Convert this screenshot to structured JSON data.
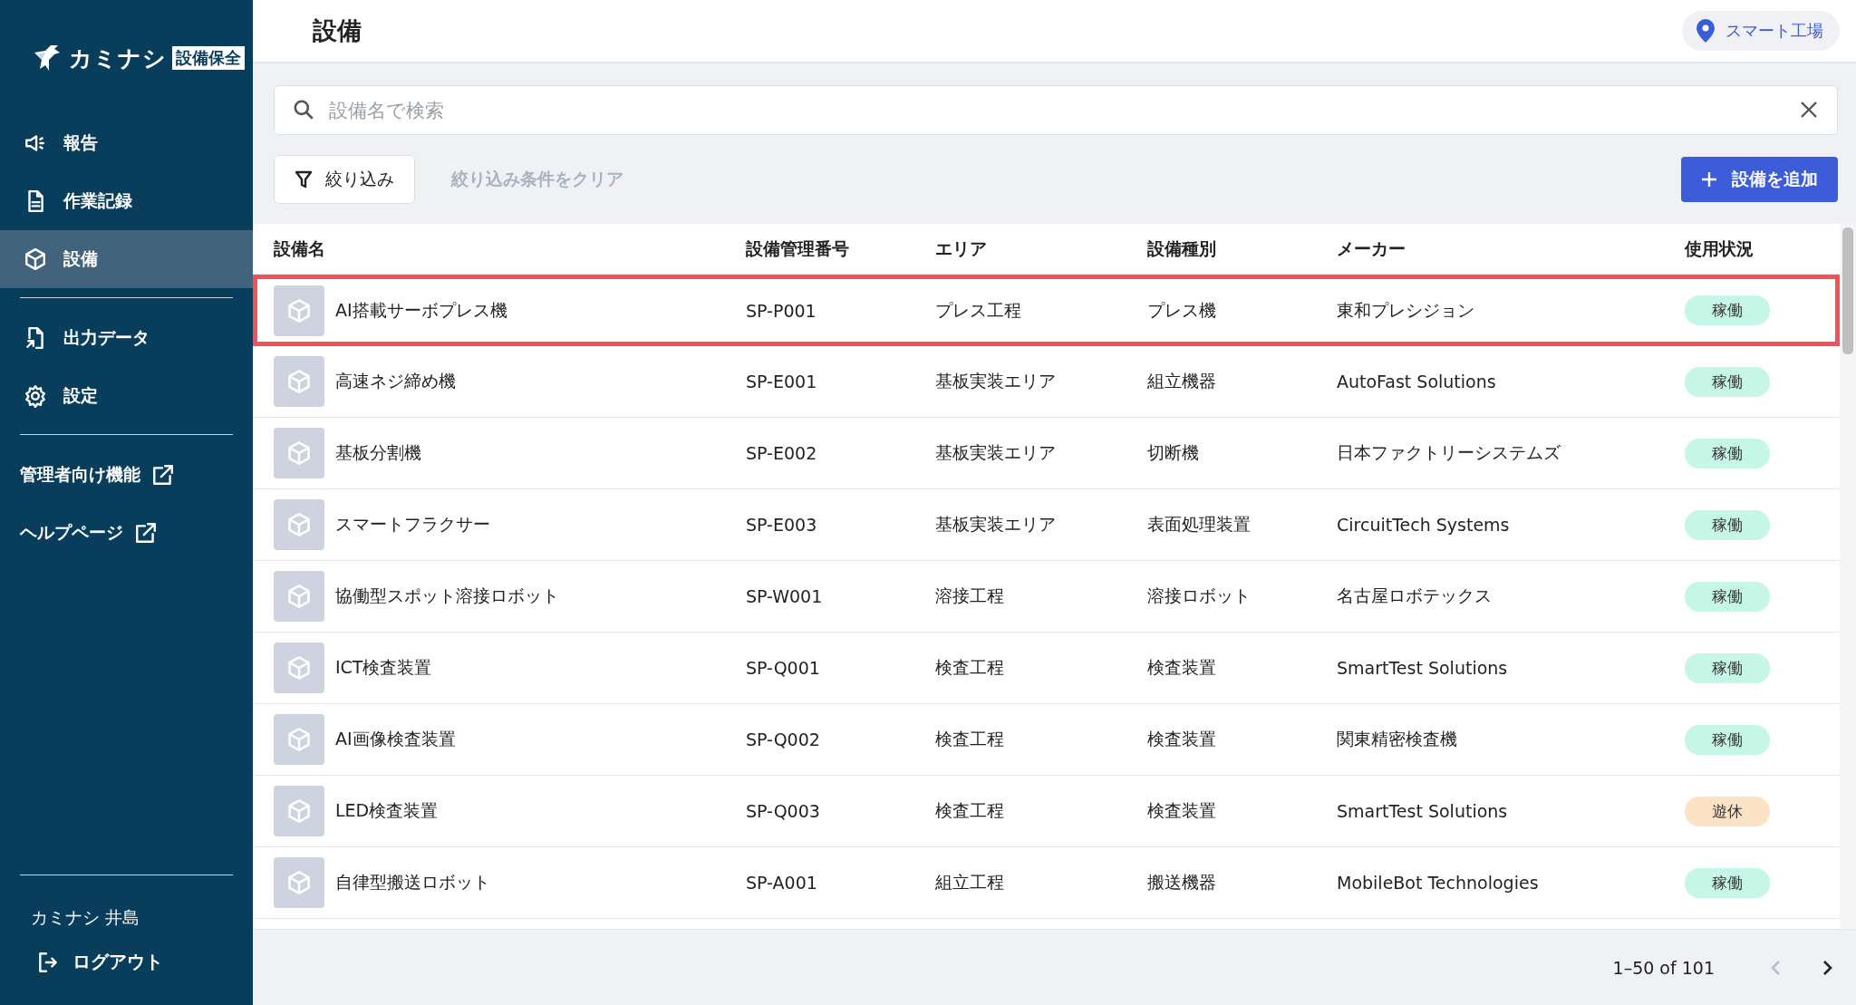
{
  "sidebar": {
    "logo": {
      "name": "カミナシ",
      "product": "設備保全"
    },
    "items": [
      {
        "label": "報告",
        "selected": false
      },
      {
        "label": "作業記録",
        "selected": false
      },
      {
        "label": "設備",
        "selected": true
      }
    ],
    "items_2": [
      {
        "label": "出力データ",
        "selected": false
      },
      {
        "label": "設定",
        "selected": false
      }
    ],
    "external_links": [
      {
        "label": "管理者向け機能"
      },
      {
        "label": "ヘルプページ"
      }
    ],
    "user": "カミナシ 井島",
    "logout": "ログアウト"
  },
  "header": {
    "title": "設備",
    "location": "スマート工場"
  },
  "search": {
    "placeholder": "設備名で検索"
  },
  "filter_button": "絞り込み",
  "clear_filter": "絞り込み条件をクリア",
  "add_button": "設備を追加",
  "table": {
    "columns": [
      "設備名",
      "設備管理番号",
      "エリア",
      "設備種別",
      "メーカー",
      "使用状況"
    ],
    "rows": [
      {
        "name": "AI搭載サーボプレス機",
        "code": "SP-P001",
        "area": "プレス工程",
        "type": "プレス機",
        "maker": "東和プレシジョン",
        "status": "稼働",
        "kind": "active",
        "selected": true
      },
      {
        "name": "高速ネジ締め機",
        "code": "SP-E001",
        "area": "基板実装エリア",
        "type": "組立機器",
        "maker": "AutoFast Solutions",
        "status": "稼働",
        "kind": "active",
        "selected": false
      },
      {
        "name": "基板分割機",
        "code": "SP-E002",
        "area": "基板実装エリア",
        "type": "切断機",
        "maker": "日本ファクトリーシステムズ",
        "status": "稼働",
        "kind": "active",
        "selected": false
      },
      {
        "name": "スマートフラクサー",
        "code": "SP-E003",
        "area": "基板実装エリア",
        "type": "表面処理装置",
        "maker": "CircuitTech Systems",
        "status": "稼働",
        "kind": "active",
        "selected": false
      },
      {
        "name": "協働型スポット溶接ロボット",
        "code": "SP-W001",
        "area": "溶接工程",
        "type": "溶接ロボット",
        "maker": "名古屋ロボテックス",
        "status": "稼働",
        "kind": "active",
        "selected": false
      },
      {
        "name": "ICT検査装置",
        "code": "SP-Q001",
        "area": "検査工程",
        "type": "検査装置",
        "maker": "SmartTest Solutions",
        "status": "稼働",
        "kind": "active",
        "selected": false
      },
      {
        "name": "AI画像検査装置",
        "code": "SP-Q002",
        "area": "検査工程",
        "type": "検査装置",
        "maker": "関東精密検査機",
        "status": "稼働",
        "kind": "active",
        "selected": false
      },
      {
        "name": "LED検査装置",
        "code": "SP-Q003",
        "area": "検査工程",
        "type": "検査装置",
        "maker": "SmartTest Solutions",
        "status": "遊休",
        "kind": "idle",
        "selected": false
      },
      {
        "name": "自律型搬送ロボット",
        "code": "SP-A001",
        "area": "組立工程",
        "type": "搬送機器",
        "maker": "MobileBot Technologies",
        "status": "稼働",
        "kind": "active",
        "selected": false
      }
    ]
  },
  "pagination": {
    "range": "1–50 of 101",
    "prev_disabled": true,
    "next_disabled": false
  }
}
